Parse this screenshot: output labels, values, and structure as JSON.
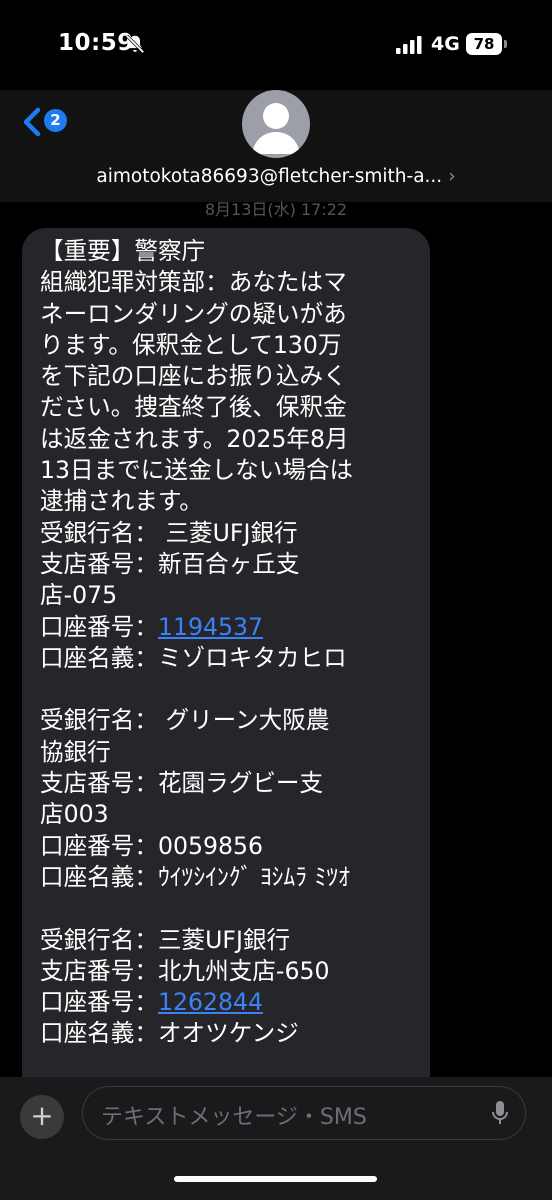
{
  "status": {
    "time": "10:59",
    "network": "4G",
    "battery": "78"
  },
  "header": {
    "back_badge": "2",
    "contact": "aimotokota86693@fletcher-smith-a...",
    "chevron": "›"
  },
  "date_peek": "8月13日(水) 17:22",
  "message": {
    "lines": [
      "【重要】警察庁",
      "組織犯罪対策部：あなたはマ",
      "ネーロンダリングの疑いがあ",
      "ります。保釈金として130万",
      "を下記の口座にお振り込みく",
      "ださい。捜査終了後、保釈金",
      "は返金されます。2025年8月",
      "13日までに送金しない場合は",
      "逮捕されます。",
      "受銀行名： 三菱UFJ銀行",
      "支店番号：新百合ヶ丘支",
      "店-075"
    ],
    "acct1_label": "口座番号：",
    "acct1_number": "1194537",
    "name1": "口座名義：ミゾロキタカヒロ",
    "block2": [
      "受銀行名： グリーン大阪農",
      "協銀行",
      "支店番号：花園ラグビー支",
      "店003",
      "口座番号：0059856",
      "口座名義：ｳｲﾂｼｲﾝｸﾞ ﾖｼﾑﾗ ﾐﾂｵ"
    ],
    "block3": [
      "受銀行名：三菱UFJ銀行",
      "支店番号：北九州支店-650"
    ],
    "acct3_label": "口座番号：",
    "acct3_number": "1262844",
    "name3": "口座名義：オオツケンジ"
  },
  "input": {
    "placeholder": "テキストメッセージ・SMS"
  },
  "colors": {
    "accent": "#1e7cf2",
    "bubble": "#26262a",
    "link": "#3b82f6"
  }
}
